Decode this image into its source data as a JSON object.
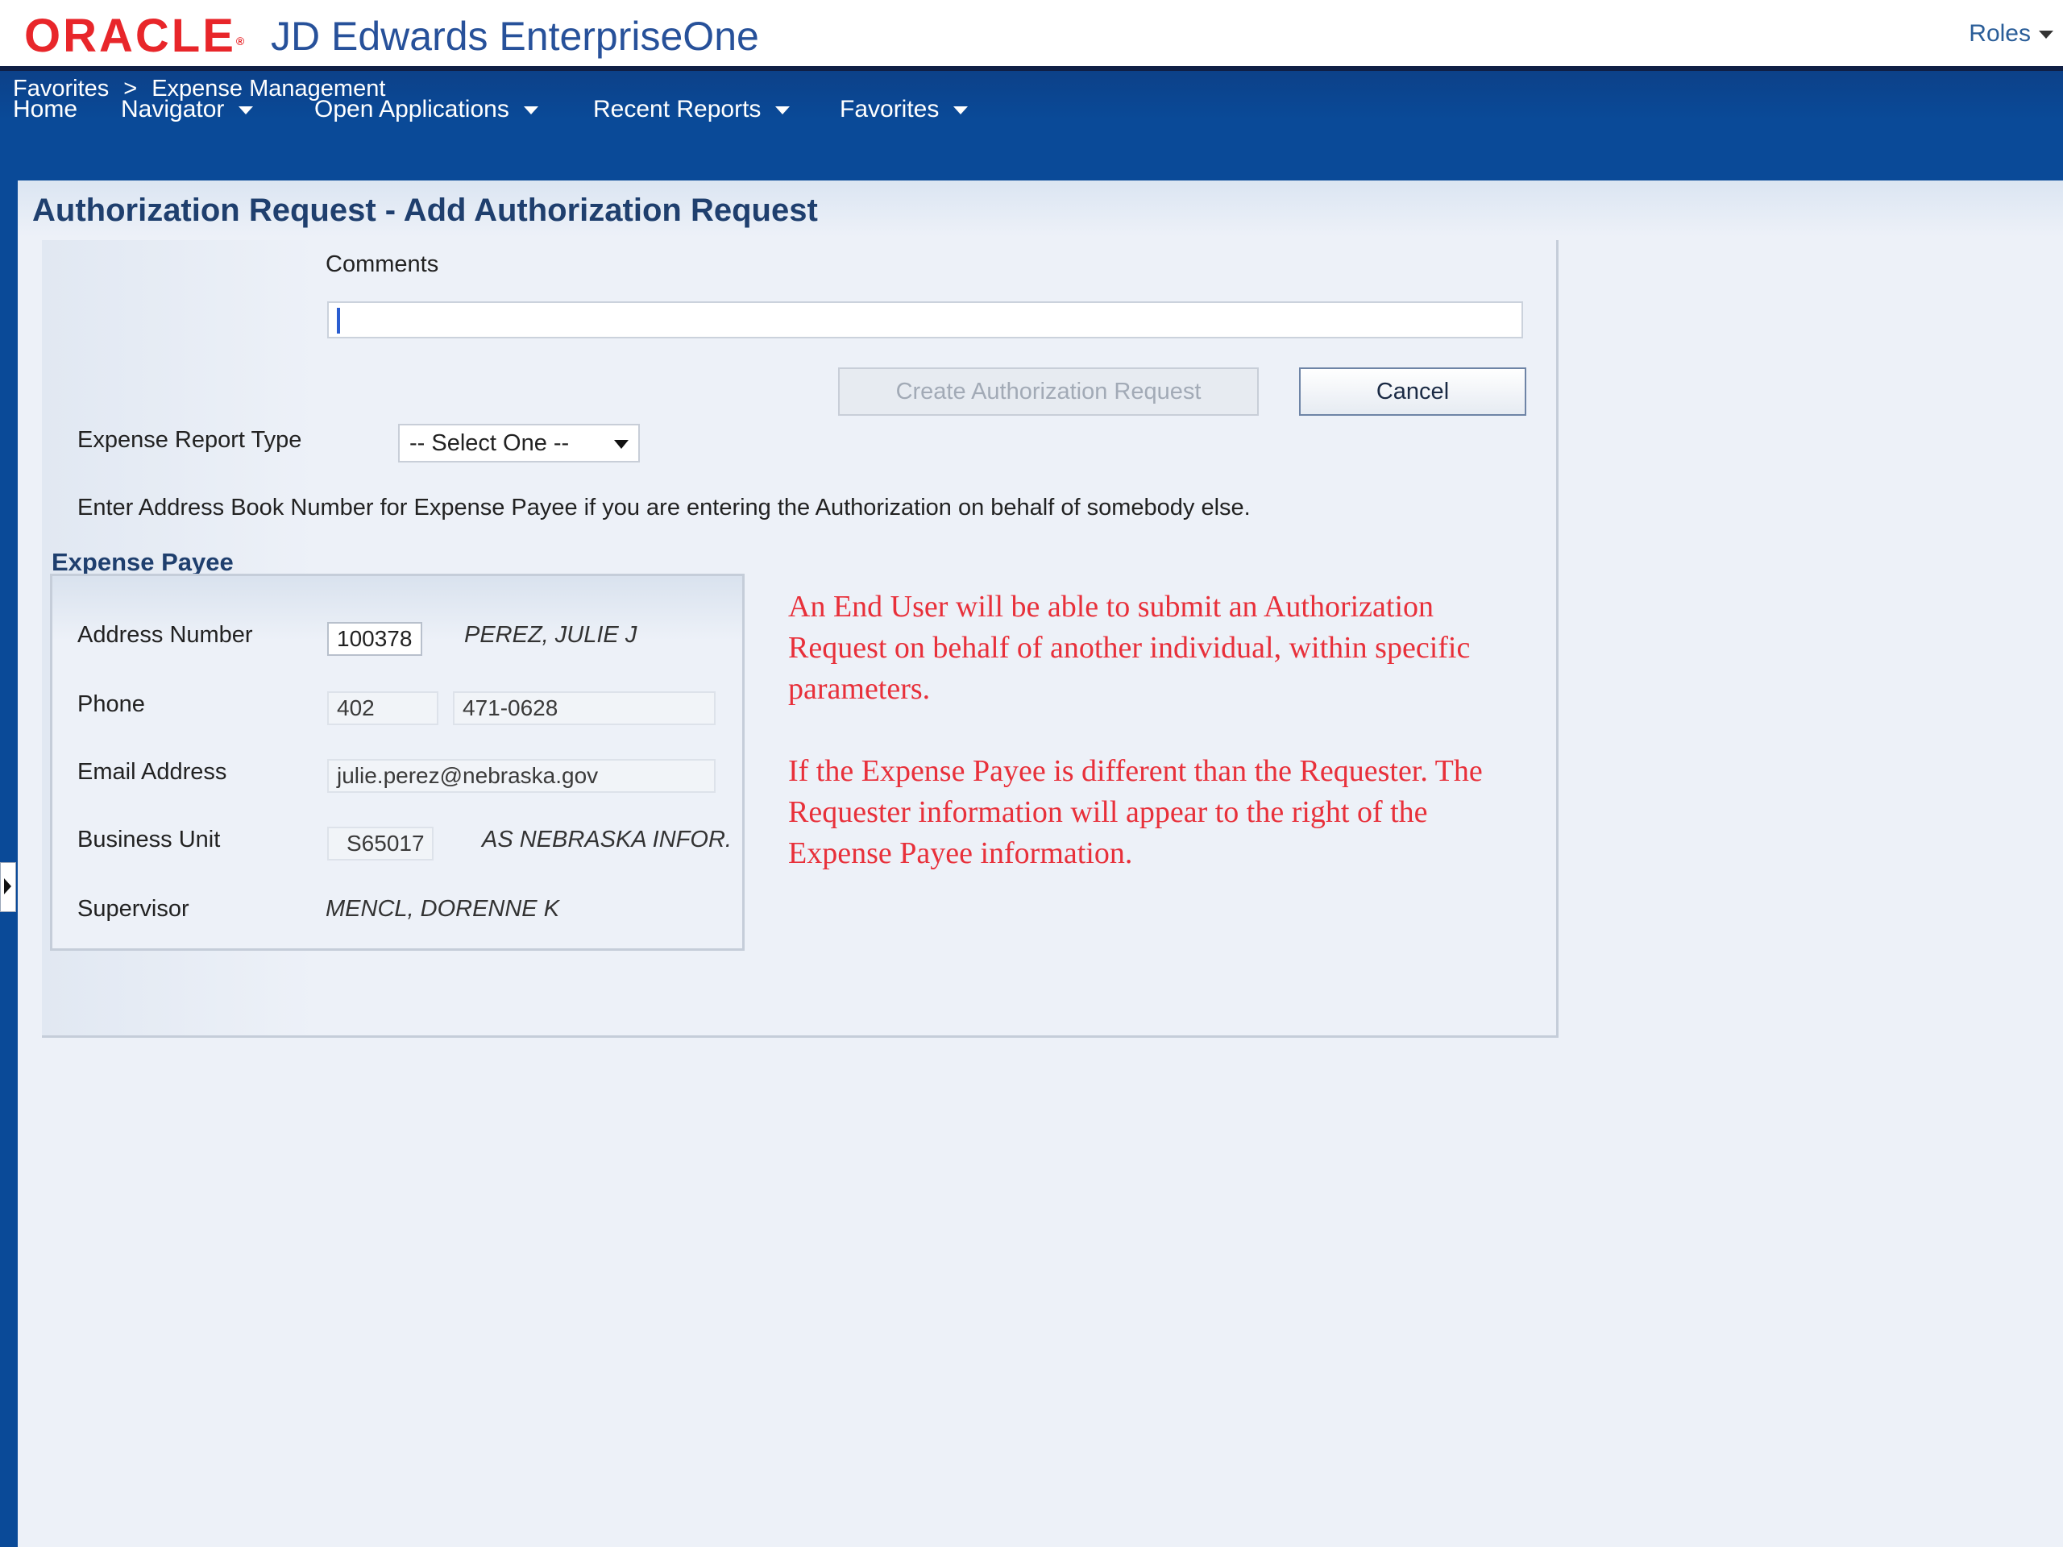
{
  "header": {
    "logo": "ORACLE",
    "product": "JD Edwards EnterpriseOne",
    "roles": "Roles"
  },
  "nav": {
    "items": [
      {
        "label": "Home",
        "has_menu": false
      },
      {
        "label": "Navigator",
        "has_menu": true
      },
      {
        "label": "Open Applications",
        "has_menu": true
      },
      {
        "label": "Recent Reports",
        "has_menu": true
      },
      {
        "label": "Favorites",
        "has_menu": true
      }
    ],
    "breadcrumb": [
      "Favorites",
      ">",
      "Expense Management"
    ]
  },
  "page": {
    "title": "Authorization Request - Add Authorization Request"
  },
  "form": {
    "comments_label": "Comments",
    "comments_value": "",
    "create_button": "Create Authorization Request",
    "cancel_button": "Cancel",
    "expense_type_label": "Expense Report Type",
    "expense_type_selected": "-- Select One --",
    "instruction": "Enter Address Book Number for Expense Payee if you are entering the Authorization on behalf of somebody else."
  },
  "payee": {
    "heading": "Expense Payee",
    "address_number_label": "Address Number",
    "address_number": "100378",
    "address_name": "PEREZ, JULIE J",
    "phone_label": "Phone",
    "phone_area": "402",
    "phone_number": "471-0628",
    "email_label": "Email Address",
    "email": "julie.perez@nebraska.gov",
    "business_unit_label": "Business Unit",
    "business_unit": "S65017",
    "business_unit_name": "AS NEBRASKA INFOR.",
    "supervisor_label": "Supervisor",
    "supervisor": "MENCL, DORENNE K"
  },
  "notes": [
    "An End User will be able to submit an Authorization Request on behalf of another individual, within specific parameters.",
    "If the Expense Payee is different than the Requester.  The Requester information will appear to the right of the Expense Payee information."
  ],
  "colors": {
    "brand_red": "#e8262a",
    "nav_blue": "#0a4a98",
    "title_blue": "#1f3f6e",
    "note_red": "#e8303a"
  }
}
